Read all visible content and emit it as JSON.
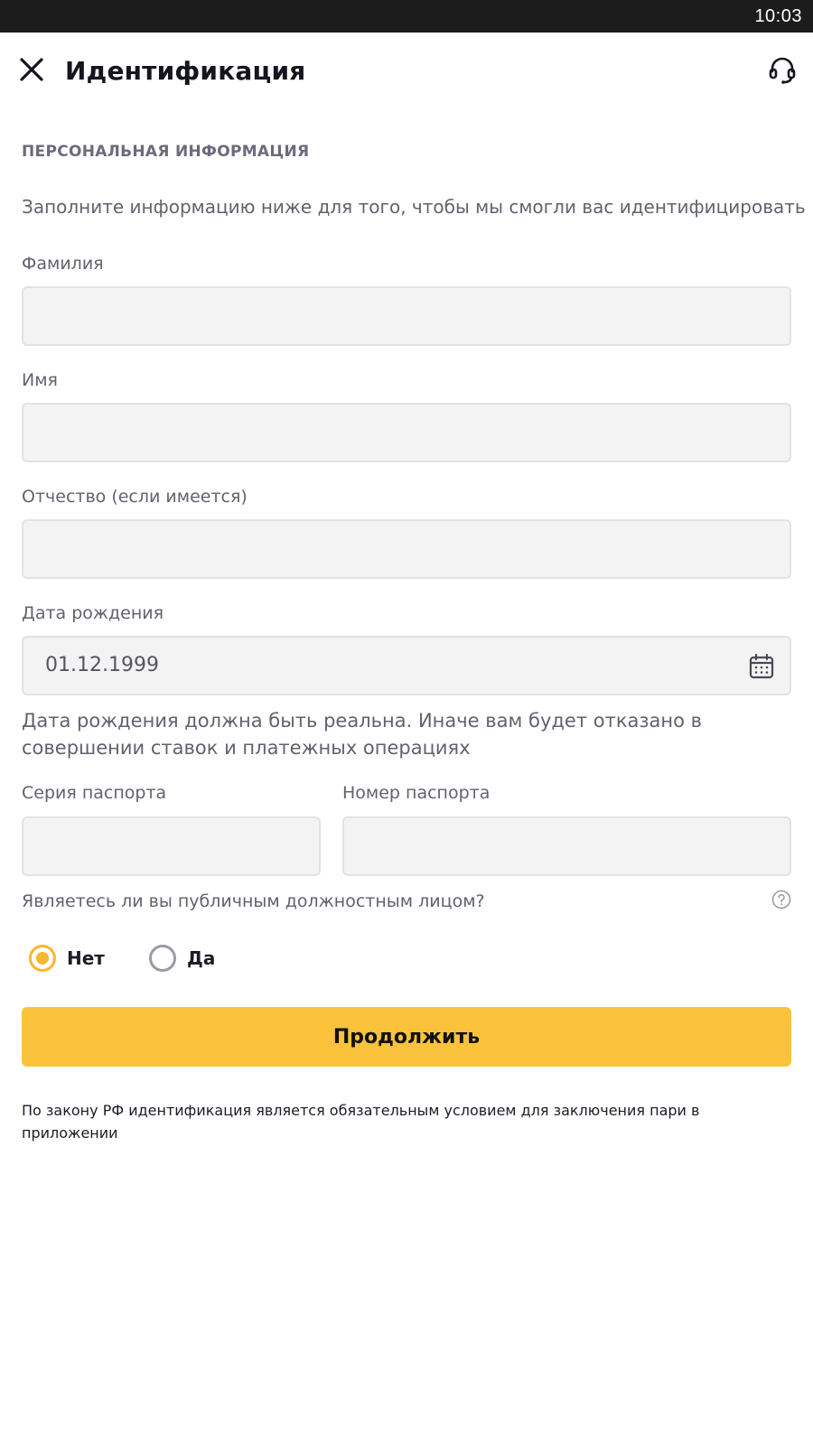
{
  "status_bar": {
    "time": "10:03"
  },
  "header": {
    "title": "Идентификация",
    "close_icon": "close-icon",
    "support_icon": "headset-icon"
  },
  "form": {
    "section_title": "ПЕРСОНАЛЬНАЯ ИНФОРМАЦИЯ",
    "intro": "Заполните информацию ниже для того, чтобы мы смогли вас идентифицировать",
    "last_name": {
      "label": "Фамилия",
      "value": ""
    },
    "first_name": {
      "label": "Имя",
      "value": ""
    },
    "patronymic": {
      "label": "Отчество (если имеется)",
      "value": ""
    },
    "birth_date": {
      "label": "Дата рождения",
      "value": "01.12.1999",
      "icon": "calendar-icon"
    },
    "birth_date_hint": "Дата рождения должна быть реальна. Иначе вам будет отказано в совершении ставок и платежных операциях",
    "passport_series": {
      "label": "Серия паспорта",
      "value": ""
    },
    "passport_number": {
      "label": "Номер паспорта",
      "value": ""
    },
    "pep_question": "Являетесь ли вы публичным должностным лицом?",
    "pep_options": [
      {
        "label": "Нет",
        "selected": true
      },
      {
        "label": "Да",
        "selected": false
      }
    ],
    "continue_label": "Продолжить",
    "legal_note": "По закону РФ идентификация является обязательным условием для заключения пари в приложении"
  },
  "colors": {
    "accent": "#fbc23c",
    "radio_selected": "#f8b731",
    "field_bg": "#f3f3f4",
    "status_bar": "#1c1c1c"
  }
}
